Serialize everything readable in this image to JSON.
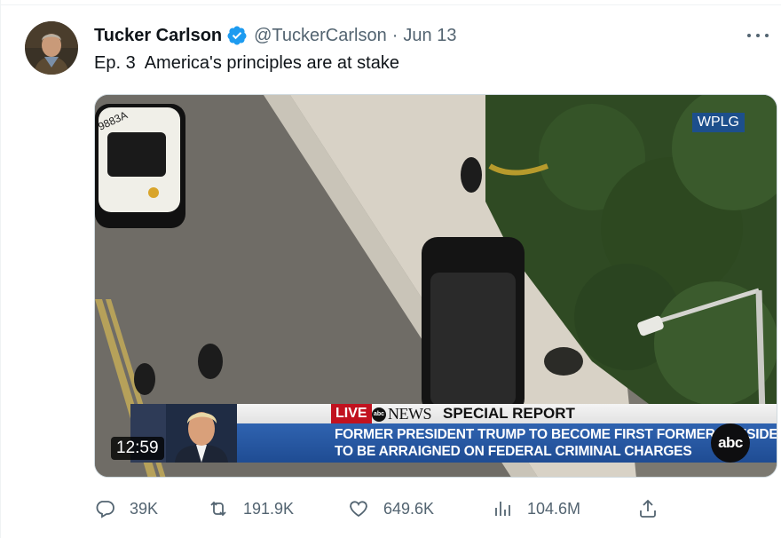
{
  "tweet": {
    "author_name": "Tucker Carlson",
    "handle": "@TuckerCarlson",
    "separator": "·",
    "date": "Jun 13",
    "text": "Ep. 3  America's principles are at stake",
    "more_icon": "more-horizontal-icon",
    "verified_icon": "verified-badge-icon"
  },
  "media": {
    "watermark": "WPLG",
    "timestamp": "12:59",
    "banner": {
      "live_label": "LIVE",
      "network_logo_small": "abc",
      "network_word": "NEWS",
      "report_label": "SPECIAL REPORT",
      "headline_line1": "FORMER PRESIDENT TRUMP TO BECOME FIRST FORMER PRESIDENT",
      "headline_line2": "TO BE ARRAIGNED ON FEDERAL CRIMINAL CHARGES",
      "network_logo": "abc"
    },
    "car_plate": "9883A"
  },
  "actions": {
    "reply_count": "39K",
    "retweet_count": "191.9K",
    "like_count": "649.6K",
    "views_count": "104.6M",
    "icons": [
      "reply-icon",
      "retweet-icon",
      "like-icon",
      "views-icon",
      "share-icon"
    ]
  },
  "colors": {
    "text_primary": "#0f1419",
    "text_secondary": "#536471",
    "verified_blue": "#1d9bf0",
    "live_red": "#c1121f",
    "banner_blue": "#2f63b0"
  }
}
